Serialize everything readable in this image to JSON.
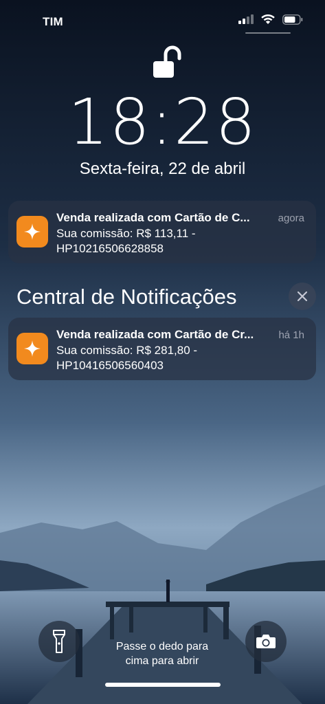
{
  "status_bar": {
    "carrier": "TIM",
    "battery_level": 0.75
  },
  "lock": {
    "time": "18:28",
    "date": "Sexta-feira, 22 de abril"
  },
  "notifications": [
    {
      "title": "Venda realizada com Cartão de C...",
      "time": "agora",
      "body_line1": "Sua comissão: R$ 113,11 -",
      "body_line2": "HP10216506628858",
      "icon": "sparkle-icon",
      "icon_color": "#f28a1e"
    }
  ],
  "notification_center": {
    "title": "Central de Notificações",
    "items": [
      {
        "title": "Venda realizada com Cartão de Cr...",
        "time": "há 1h",
        "body_line1": "Sua comissão: R$ 281,80 -",
        "body_line2": "HP10416506560403",
        "icon": "sparkle-icon",
        "icon_color": "#f28a1e"
      }
    ]
  },
  "bottom": {
    "swipe_hint_line1": "Passe o dedo para",
    "swipe_hint_line2": "cima para abrir",
    "left_button_icon": "flashlight-icon",
    "right_button_icon": "camera-icon"
  }
}
